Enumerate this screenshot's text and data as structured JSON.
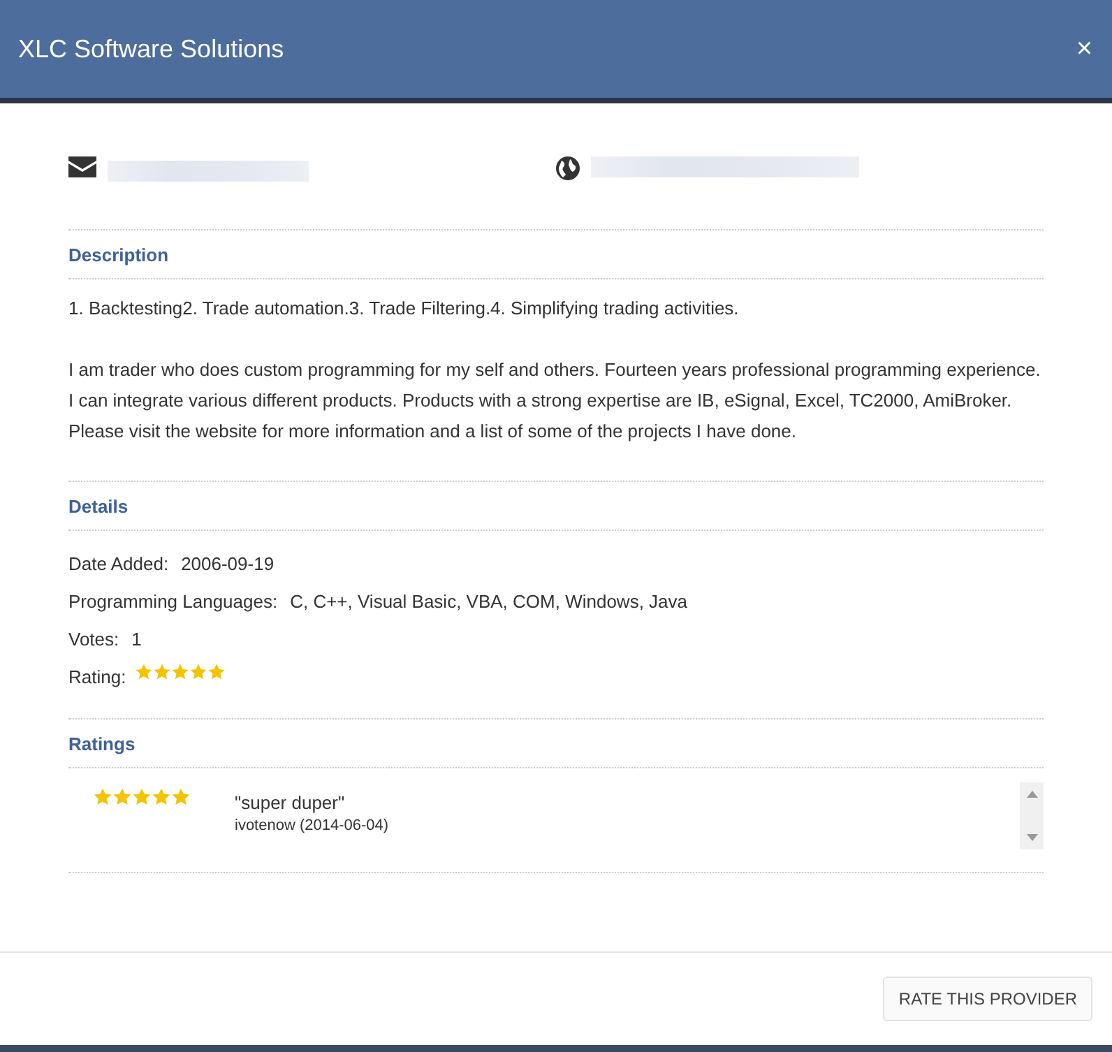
{
  "window": {
    "title": "XLC Software Solutions",
    "close": "×"
  },
  "sections": [
    {
      "kind": "description",
      "title": "Description",
      "paragraphs": [
        "1. Backtesting2. Trade automation.3. Trade Filtering.4. Simplifying trading activities.",
        "I am trader who does custom programming for my self and others. Fourteen years professional programming experience. I can integrate various different products. Products with a strong expertise are IB, eSignal, Excel, TC2000, AmiBroker. Please visit the website for more information and a list of some of the projects I have done."
      ]
    },
    {
      "kind": "details",
      "title": "Details",
      "fields": [
        {
          "label": "Date Added:",
          "value": "2006-09-19"
        },
        {
          "label": "Programming Languages:",
          "value": "C, C++, Visual Basic, VBA, COM, Windows, Java"
        },
        {
          "label": "Votes:",
          "value": "1"
        }
      ],
      "rating": {
        "label": "Rating:",
        "stars": 5
      }
    },
    {
      "kind": "ratings",
      "title": "Ratings",
      "items": [
        {
          "stars": 5,
          "comment": "\"super duper\"",
          "author": "ivotenow (2014-06-04)"
        }
      ]
    }
  ],
  "footer": {
    "button": "RATE THIS PROVIDER"
  }
}
